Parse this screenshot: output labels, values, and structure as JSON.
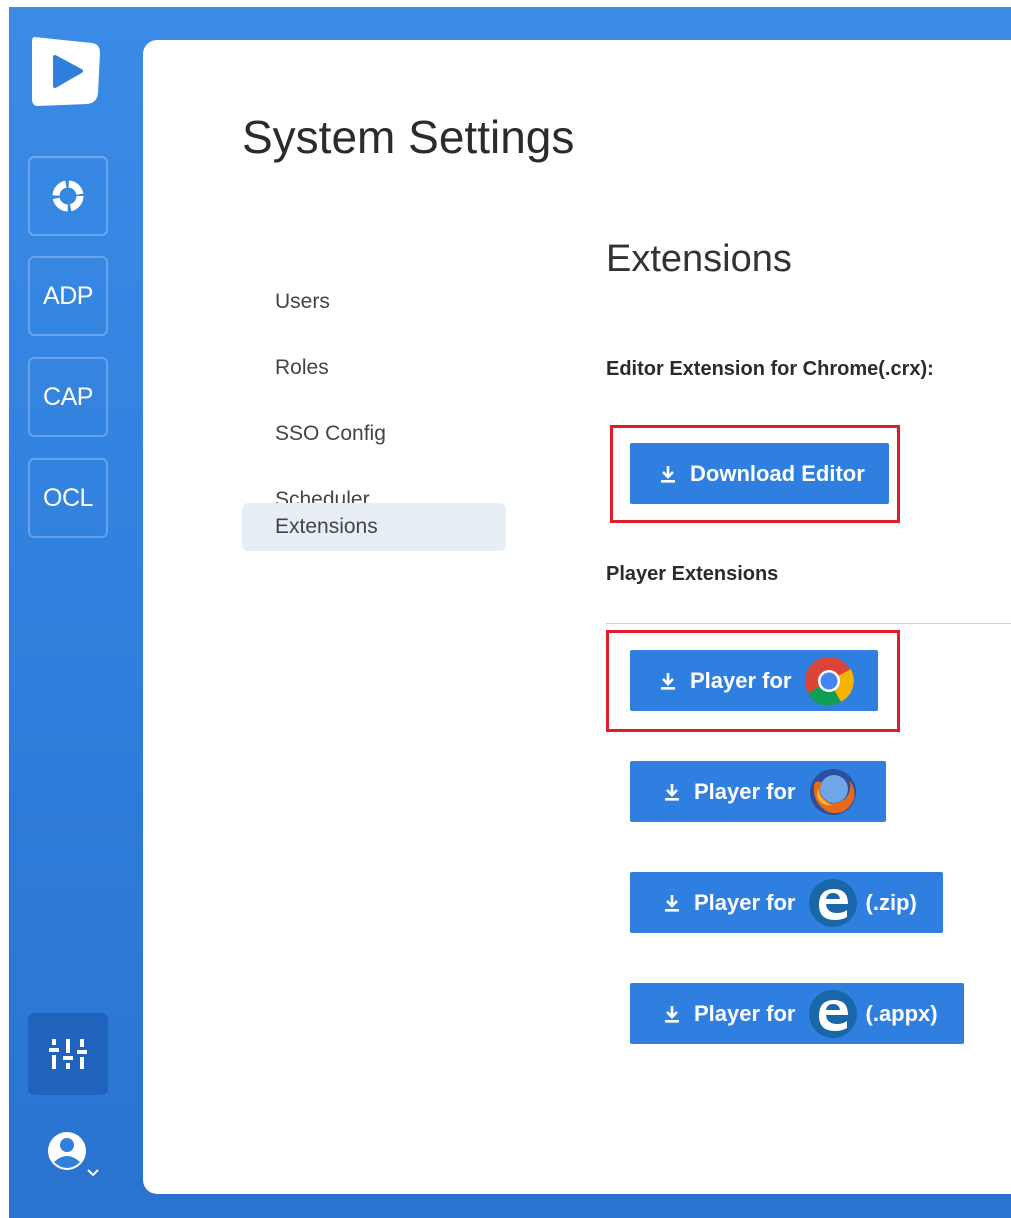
{
  "sidebar": {
    "items": [
      {
        "name": "refresh",
        "icon": "refresh-icon",
        "label": ""
      },
      {
        "name": "adp",
        "label": "ADP"
      },
      {
        "name": "cap",
        "label": "CAP"
      },
      {
        "name": "ocl",
        "label": "OCL"
      }
    ],
    "bottom": {
      "settings_icon": "sliders-icon",
      "user_icon": "user-icon"
    }
  },
  "page": {
    "title": "System Settings"
  },
  "settings_nav": {
    "items": [
      {
        "label": "Users"
      },
      {
        "label": "Roles"
      },
      {
        "label": "SSO Config"
      },
      {
        "label": "Scheduler"
      },
      {
        "label": "Extensions",
        "active": true
      }
    ]
  },
  "content": {
    "section_title": "Extensions",
    "editor_label": "Editor Extension for Chrome(.crx):",
    "editor_button": "Download Editor",
    "player_label": "Player Extensions",
    "player_buttons": [
      {
        "label": "Player for",
        "browser": "chrome-icon",
        "suffix": ""
      },
      {
        "label": "Player for",
        "browser": "firefox-icon",
        "suffix": ""
      },
      {
        "label": "Player for",
        "browser": "edge-icon",
        "suffix": "(.zip)"
      },
      {
        "label": "Player for",
        "browser": "edge-icon",
        "suffix": "(.appx)"
      }
    ]
  },
  "colors": {
    "brand": "#2f7fdc",
    "button": "#2f7fe0",
    "highlight": "#e01e2b"
  }
}
